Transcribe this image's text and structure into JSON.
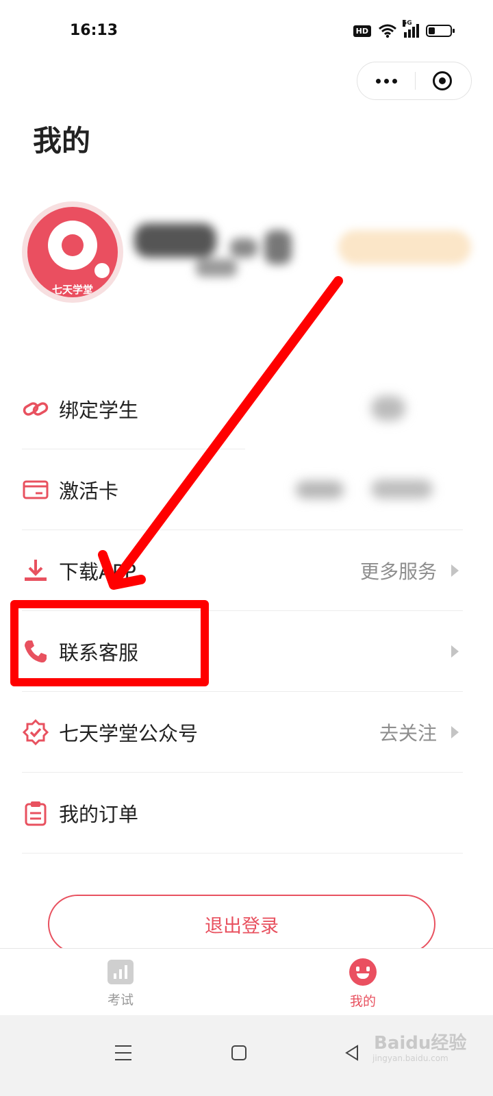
{
  "status_bar": {
    "time": "16:13",
    "hd_label": "HD",
    "network_label": "5G",
    "battery_percent": 30
  },
  "capsule": {
    "more_icon": "more-dots-icon",
    "close_icon": "target-circle-icon"
  },
  "page": {
    "title": "我的"
  },
  "profile": {
    "avatar_brand_text": "七天学堂"
  },
  "menu": {
    "items": [
      {
        "label": "绑定学生",
        "icon": "link-icon",
        "extra": ""
      },
      {
        "label": "激活卡",
        "icon": "card-icon",
        "extra": ""
      },
      {
        "label": "下载APP",
        "icon": "download-icon",
        "extra": "更多服务"
      },
      {
        "label": "联系客服",
        "icon": "phone-icon",
        "extra": ""
      },
      {
        "label": "七天学堂公众号",
        "icon": "badge-check-icon",
        "extra": "去关注"
      },
      {
        "label": "我的订单",
        "icon": "clipboard-icon",
        "extra": ""
      }
    ]
  },
  "logout": {
    "label": "退出登录"
  },
  "tab_bar": {
    "tabs": [
      {
        "label": "考试",
        "icon": "bar-chart-icon",
        "active": false
      },
      {
        "label": "我的",
        "icon": "smile-icon",
        "active": true
      }
    ]
  },
  "watermark": {
    "text": "Baidu经验",
    "sub": "jingyan.baidu.com"
  },
  "colors": {
    "accent": "#e8515f",
    "annotation": "#ff0000"
  }
}
